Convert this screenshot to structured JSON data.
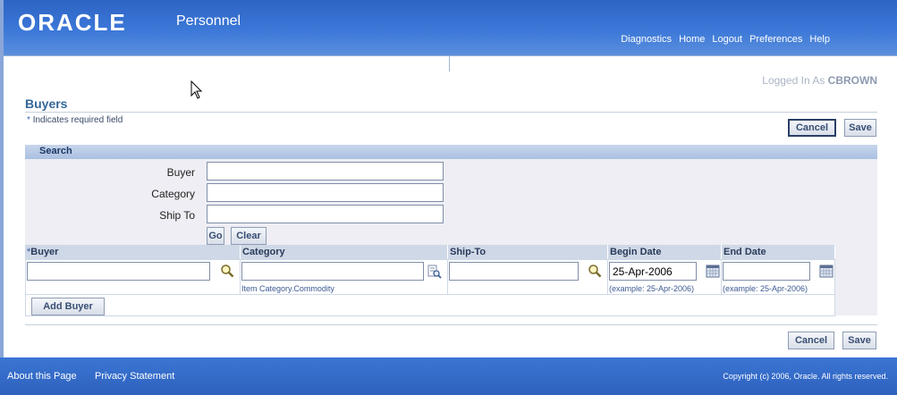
{
  "header": {
    "logo": "ORACLE",
    "app_title": "Personnel",
    "links": [
      "Diagnostics",
      "Home",
      "Logout",
      "Preferences",
      "Help"
    ]
  },
  "user": {
    "logged_in_label": "Logged In As",
    "username": "CBROWN"
  },
  "page": {
    "title": "Buyers",
    "required_note": "Indicates required field",
    "cancel_label": "Cancel",
    "save_label": "Save"
  },
  "search": {
    "heading": "Search",
    "fields": [
      {
        "label": "Buyer",
        "value": ""
      },
      {
        "label": "Category",
        "value": ""
      },
      {
        "label": "Ship To",
        "value": ""
      }
    ],
    "go_label": "Go",
    "clear_label": "Clear"
  },
  "table": {
    "columns": [
      "Buyer",
      "Category",
      "Ship-To",
      "Begin Date",
      "End Date"
    ],
    "row": {
      "buyer": "",
      "category": "",
      "category_hint": "Item Category.Commodity",
      "ship_to": "",
      "begin_date": "25-Apr-2006",
      "begin_hint": "(example: 25-Apr-2006)",
      "end_date": "",
      "end_hint": "(example: 25-Apr-2006)"
    },
    "add_label": "Add Buyer"
  },
  "footer": {
    "about": "About this Page",
    "privacy": "Privacy Statement",
    "copyright": "Copyright (c) 2006, Oracle. All rights reserved."
  },
  "icons": {
    "search": "magnifier-icon",
    "lov": "list-search-icon",
    "calendar": "calendar-icon"
  },
  "colors": {
    "brand": "#2d64c4",
    "title": "#336699"
  }
}
